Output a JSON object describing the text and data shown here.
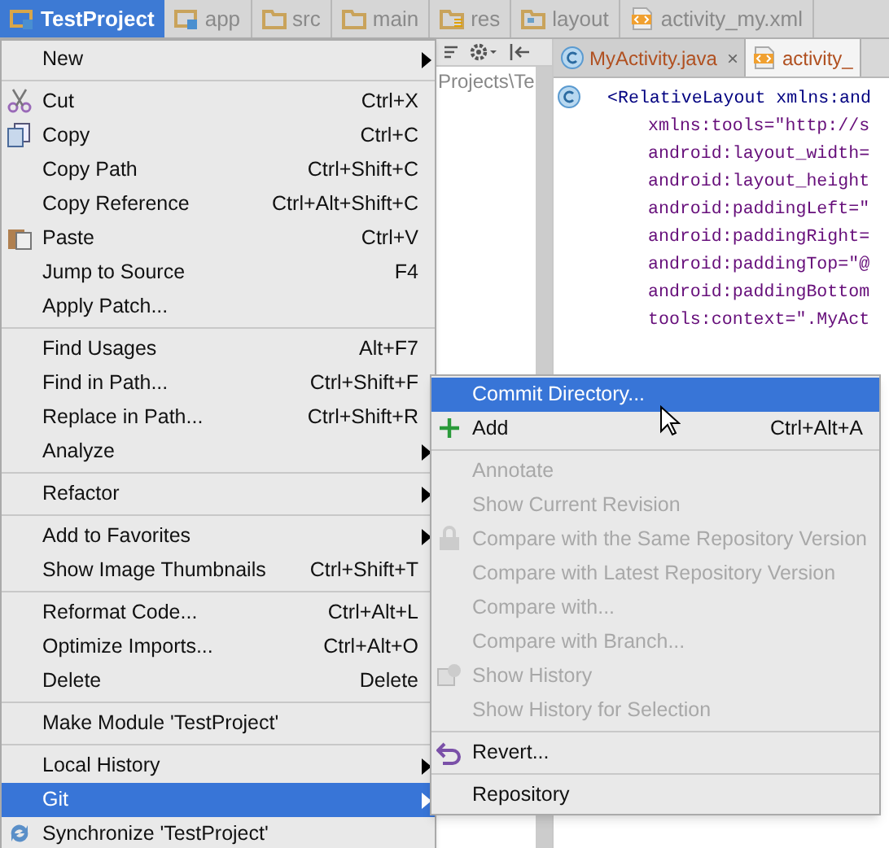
{
  "breadcrumb": [
    {
      "label": "TestProject",
      "selected": true,
      "kind": "project"
    },
    {
      "label": "app",
      "selected": false,
      "kind": "module"
    },
    {
      "label": "src",
      "selected": false,
      "kind": "folder"
    },
    {
      "label": "main",
      "selected": false,
      "kind": "folder"
    },
    {
      "label": "res",
      "selected": false,
      "kind": "res"
    },
    {
      "label": "layout",
      "selected": false,
      "kind": "layout"
    },
    {
      "label": "activity_my.xml",
      "selected": false,
      "kind": "xml"
    }
  ],
  "project_pane": {
    "path": "Projects\\Te"
  },
  "editor_tabs": [
    {
      "label": "MyActivity.java",
      "selected": false,
      "kind": "class",
      "close": "×"
    },
    {
      "label": "activity_",
      "selected": true,
      "kind": "xml"
    }
  ],
  "code_lines": [
    "<RelativeLayout xmlns:and",
    "xmlns:tools=\"http://s",
    "android:layout_width=",
    "android:layout_height",
    "android:paddingLeft=\"",
    "android:paddingRight=",
    "android:paddingTop=\"@",
    "android:paddingBottom",
    "tools:context=\".MyAct"
  ],
  "context_menu": [
    [
      {
        "label": "New",
        "kind": "plain",
        "submenu": true,
        "selected": false
      }
    ],
    [
      {
        "label": "Cut",
        "shortcut": "Ctrl+X",
        "kind": "cut",
        "selected": false
      },
      {
        "label": "Copy",
        "shortcut": "Ctrl+C",
        "kind": "copy",
        "selected": false
      },
      {
        "label": "Copy Path",
        "shortcut": "Ctrl+Shift+C",
        "kind": "plain",
        "selected": false
      },
      {
        "label": "Copy Reference",
        "shortcut": "Ctrl+Alt+Shift+C",
        "kind": "plain",
        "selected": false
      },
      {
        "label": "Paste",
        "shortcut": "Ctrl+V",
        "kind": "paste",
        "selected": false
      },
      {
        "label": "Jump to Source",
        "shortcut": "F4",
        "kind": "plain",
        "selected": false
      },
      {
        "label": "Apply Patch...",
        "kind": "plain",
        "selected": false
      }
    ],
    [
      {
        "label": "Find Usages",
        "shortcut": "Alt+F7",
        "kind": "plain",
        "selected": false
      },
      {
        "label": "Find in Path...",
        "shortcut": "Ctrl+Shift+F",
        "kind": "plain",
        "selected": false
      },
      {
        "label": "Replace in Path...",
        "shortcut": "Ctrl+Shift+R",
        "kind": "plain",
        "selected": false
      },
      {
        "label": "Analyze",
        "kind": "plain",
        "submenu": true,
        "selected": false
      }
    ],
    [
      {
        "label": "Refactor",
        "kind": "plain",
        "submenu": true,
        "selected": false
      }
    ],
    [
      {
        "label": "Add to Favorites",
        "kind": "plain",
        "submenu": true,
        "selected": false
      },
      {
        "label": "Show Image Thumbnails",
        "shortcut": "Ctrl+Shift+T",
        "kind": "plain",
        "selected": false
      }
    ],
    [
      {
        "label": "Reformat Code...",
        "shortcut": "Ctrl+Alt+L",
        "kind": "plain",
        "selected": false
      },
      {
        "label": "Optimize Imports...",
        "shortcut": "Ctrl+Alt+O",
        "kind": "plain",
        "selected": false
      },
      {
        "label": "Delete",
        "shortcut": "Delete",
        "kind": "plain",
        "selected": false
      }
    ],
    [
      {
        "label": "Make Module 'TestProject'",
        "kind": "plain",
        "selected": false
      }
    ],
    [
      {
        "label": "Local History",
        "kind": "plain",
        "submenu": true,
        "selected": false
      },
      {
        "label": "Git",
        "kind": "plain",
        "submenu": true,
        "selected": true
      },
      {
        "label": "Synchronize 'TestProject'",
        "kind": "sync",
        "selected": false
      }
    ]
  ],
  "git_submenu": [
    [
      {
        "label": "Commit Directory...",
        "kind": "plain",
        "selected": true,
        "disabled": false
      },
      {
        "label": "Add",
        "shortcut": "Ctrl+Alt+A",
        "kind": "add",
        "selected": false,
        "disabled": false
      }
    ],
    [
      {
        "label": "Annotate",
        "kind": "plain",
        "selected": false,
        "disabled": true
      },
      {
        "label": "Show Current Revision",
        "kind": "plain",
        "selected": false,
        "disabled": true
      },
      {
        "label": "Compare with the Same Repository Version",
        "kind": "compare",
        "selected": false,
        "disabled": true
      },
      {
        "label": "Compare with Latest Repository Version",
        "kind": "plain",
        "selected": false,
        "disabled": true
      },
      {
        "label": "Compare with...",
        "kind": "plain",
        "selected": false,
        "disabled": true
      },
      {
        "label": "Compare with Branch...",
        "kind": "plain",
        "selected": false,
        "disabled": true
      },
      {
        "label": "Show History",
        "kind": "history",
        "selected": false,
        "disabled": true
      },
      {
        "label": "Show History for Selection",
        "kind": "plain",
        "selected": false,
        "disabled": true
      }
    ],
    [
      {
        "label": "Revert...",
        "kind": "revert",
        "selected": false,
        "disabled": false
      }
    ],
    [
      {
        "label": "Repository",
        "kind": "plain",
        "selected": false,
        "disabled": false
      }
    ]
  ]
}
